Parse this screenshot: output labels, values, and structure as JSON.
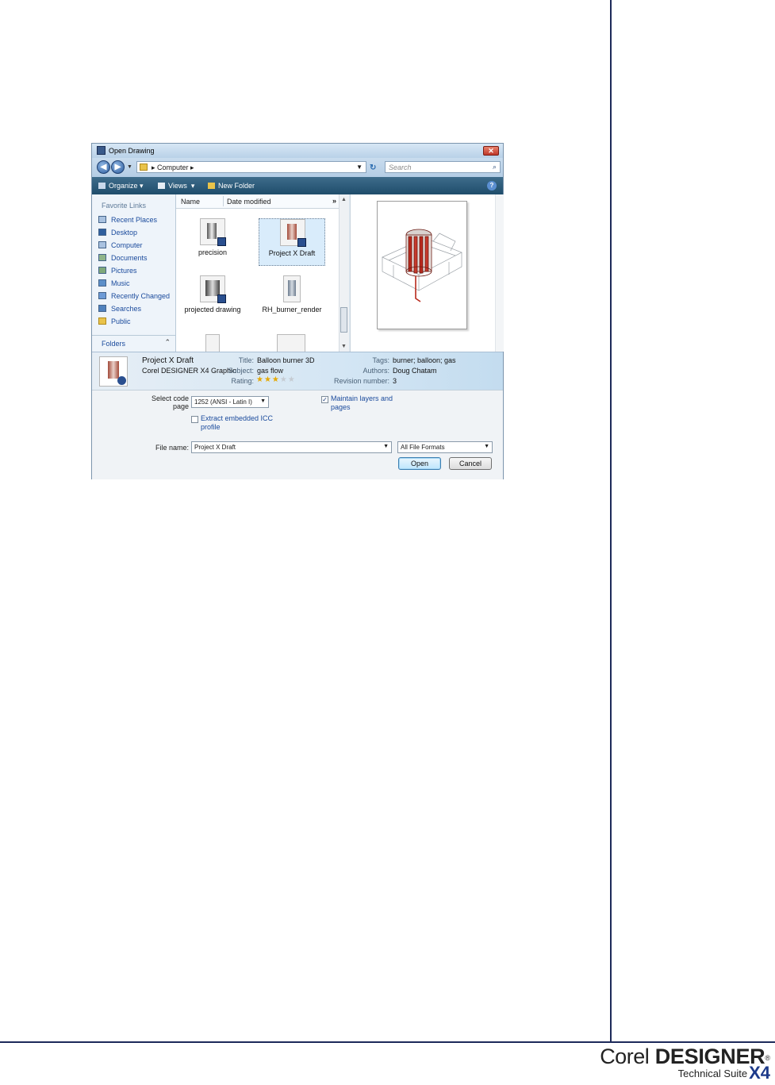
{
  "dialog": {
    "title": "Open Drawing",
    "close_label": "✕"
  },
  "nav": {
    "back_glyph": "◀",
    "forward_glyph": "▶",
    "address": "▸ Computer ▸",
    "refresh_glyph": "↻",
    "search_placeholder": "Search",
    "search_glyph": "⌕"
  },
  "toolbar": {
    "organize": "Organize",
    "views": "Views",
    "new_folder": "New Folder",
    "help_glyph": "?"
  },
  "favorites": {
    "header": "Favorite Links",
    "items": [
      {
        "label": "Recent Places"
      },
      {
        "label": "Desktop"
      },
      {
        "label": "Computer"
      },
      {
        "label": "Documents"
      },
      {
        "label": "Pictures"
      },
      {
        "label": "Music"
      },
      {
        "label": "Recently Changed"
      },
      {
        "label": "Searches"
      },
      {
        "label": "Public"
      }
    ],
    "folders_label": "Folders",
    "folders_chevron": "⌃"
  },
  "files": {
    "col_name": "Name",
    "col_date": "Date modified",
    "col_more": "»",
    "items": [
      {
        "label": "precision"
      },
      {
        "label": "Project X Draft"
      },
      {
        "label": "projected drawing"
      },
      {
        "label": "RH_burner_render"
      }
    ]
  },
  "details": {
    "file_name": "Project X Draft",
    "file_type": "Corel DESIGNER X4 Graphic",
    "title_label": "Title:",
    "title_value": "Balloon burner 3D",
    "subject_label": "Subject:",
    "subject_value": "gas flow",
    "rating_label": "Rating:",
    "rating": 3,
    "rating_max": 5,
    "tags_label": "Tags:",
    "tags_value": "burner; balloon; gas",
    "authors_label": "Authors:",
    "authors_value": "Doug Chatam",
    "revision_label": "Revision number:",
    "revision_value": "3"
  },
  "options": {
    "code_page_label_1": "Select code",
    "code_page_label_2": "page",
    "code_page_value": "1252  (ANSI - Latin I)",
    "maintain_label_1": "Maintain layers and",
    "maintain_label_2": "pages",
    "maintain_checked": true,
    "extract_label_1": "Extract embedded ICC",
    "extract_label_2": "profile",
    "extract_checked": false,
    "file_name_label": "File name:",
    "file_name_value": "Project X Draft",
    "file_type_value": "All File Formats",
    "open_button": "Open",
    "cancel_button": "Cancel"
  },
  "brand": {
    "corel": "Corel",
    "designer": "DESIGNER",
    "reg": "®",
    "suite": "Technical Suite",
    "x4": "X4"
  }
}
